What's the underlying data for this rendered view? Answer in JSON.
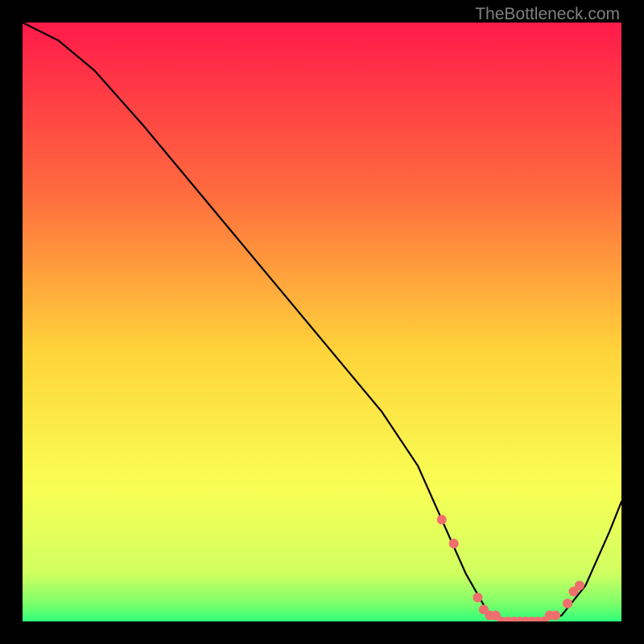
{
  "attribution": "TheBottleneck.com",
  "colors": {
    "top": "#ff1a4a",
    "mid_upper": "#ff8a3a",
    "mid": "#ffe83a",
    "mid_lower": "#f5ff66",
    "bottom": "#2eff7a",
    "curve": "#000000",
    "marker_fill": "#ef6e6e",
    "marker_stroke": "#ef6e6e"
  },
  "chart_data": {
    "type": "line",
    "title": "",
    "xlabel": "",
    "ylabel": "",
    "xlim": [
      0,
      100
    ],
    "ylim": [
      0,
      100
    ],
    "series": [
      {
        "name": "bottleneck-curve",
        "x": [
          0,
          6,
          12,
          20,
          30,
          40,
          50,
          60,
          66,
          70,
          74,
          78,
          82,
          86,
          90,
          94,
          98,
          100
        ],
        "values": [
          100,
          97,
          92,
          83,
          71,
          59,
          47,
          35,
          26,
          17,
          8,
          1,
          0,
          0,
          1,
          6,
          15,
          20
        ]
      }
    ],
    "markers": {
      "x": [
        70,
        72,
        76,
        77,
        78,
        79,
        80,
        81,
        82,
        83,
        84,
        85,
        86,
        87,
        88,
        89,
        91,
        92,
        93
      ],
      "values": [
        17,
        13,
        4,
        2,
        1,
        1,
        0,
        0,
        0,
        0,
        0,
        0,
        0,
        0,
        1,
        1,
        3,
        5,
        6
      ]
    },
    "gradient_stops": [
      {
        "offset": 0,
        "color": "#ff1a4a"
      },
      {
        "offset": 28,
        "color": "#ff6a3e"
      },
      {
        "offset": 55,
        "color": "#ffd43a"
      },
      {
        "offset": 78,
        "color": "#f8ff55"
      },
      {
        "offset": 92,
        "color": "#d0ff60"
      },
      {
        "offset": 97,
        "color": "#7dff6a"
      },
      {
        "offset": 100,
        "color": "#2eff7a"
      }
    ]
  }
}
